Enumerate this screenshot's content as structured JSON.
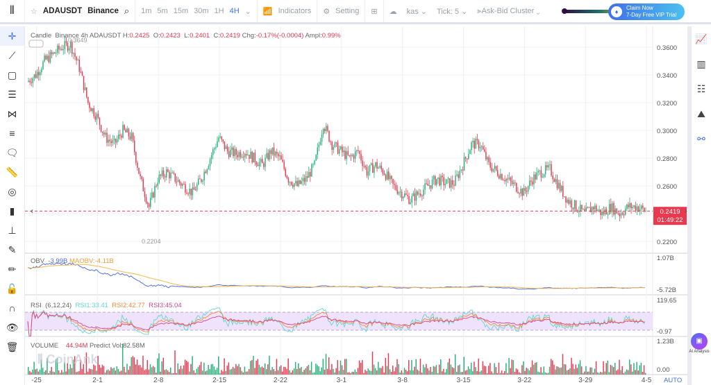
{
  "topbar": {
    "symbol": "ADAUSDT",
    "exchange": "Binance",
    "timeframes": [
      "1m",
      "5m",
      "15m",
      "30m",
      "1H",
      "4H"
    ],
    "active_timeframe": "4H",
    "indicators": "Indicators",
    "setting": "Setting",
    "kas": "kas",
    "tick": "Tick: 5",
    "cluster": "Ask-Bid Cluster",
    "claim_line1": "Claim Now",
    "claim_line2": "7-Day Free VIP Trial"
  },
  "legend": {
    "type": "Candle",
    "source": "Binance 4h ADAUSDT",
    "h_label": "H:",
    "h": "0.2425",
    "o_label": "O:",
    "o": "0.2423",
    "l_label": "L:",
    "l": "0.2401",
    "c_label": "C:",
    "c": "0.2419",
    "chg_label": "Chg:",
    "chg": "-0.17%(-0.0004)",
    "ampl_label": "Ampl:",
    "ampl": "0.99%",
    "high_mark": "0.3649",
    "low_mark": "0.2204"
  },
  "obv": {
    "label": "OBV",
    "value": "-3.99B",
    "ma": "MAOBV:-4.11B",
    "axis_top": "1.07B",
    "axis_bottom": "-5.72B"
  },
  "rsi": {
    "label": "RSI",
    "params": "(6,12,24)",
    "rsi1": "RSI1:33.41",
    "rsi2": "RSI2:42.77",
    "rsi3": "RSI3:45.04",
    "axis_top": "119.65",
    "axis_bottom": "-0.97"
  },
  "volume": {
    "label": "VOLUME",
    "value": "44.94M",
    "predict": "Predict Vol:82.58M",
    "axis_top": "1.23B",
    "axis_bottom": "0.00"
  },
  "price_axis": [
    "0.3600",
    "0.3400",
    "0.3200",
    "0.3000",
    "0.2800",
    "0.2600",
    "0.2200"
  ],
  "current_price": "0.2419",
  "countdown": "01:49:22",
  "x_axis": [
    "-25",
    "2-1",
    "2-8",
    "2-15",
    "2-22",
    "3-1",
    "3-8",
    "3-15",
    "3-22",
    "3-29",
    "4-5"
  ],
  "auto": "AUTO",
  "watermark": "CoinAnk",
  "ai_label": "AI Analysis",
  "colors": {
    "up": "#26b07a",
    "down": "#e8394f",
    "accent": "#3f6fe8",
    "obv": "#5470e0",
    "maobv": "#f2b84b",
    "rsi1": "#5fd6d0",
    "rsi2": "#f28a3c",
    "rsi3": "#d9448f"
  },
  "chart_data": {
    "type": "candlestick",
    "x_unit": "day",
    "start": "1-24",
    "ylim": [
      0.21,
      0.37
    ],
    "daily_close": [
      0.335,
      0.34,
      0.35,
      0.355,
      0.36,
      0.362,
      0.345,
      0.32,
      0.31,
      0.295,
      0.29,
      0.3,
      0.295,
      0.265,
      0.245,
      0.265,
      0.27,
      0.265,
      0.26,
      0.255,
      0.265,
      0.28,
      0.295,
      0.285,
      0.283,
      0.285,
      0.28,
      0.275,
      0.285,
      0.28,
      0.265,
      0.26,
      0.265,
      0.275,
      0.305,
      0.29,
      0.285,
      0.28,
      0.285,
      0.27,
      0.275,
      0.27,
      0.26,
      0.255,
      0.25,
      0.255,
      0.26,
      0.265,
      0.262,
      0.262,
      0.275,
      0.29,
      0.29,
      0.275,
      0.27,
      0.265,
      0.26,
      0.255,
      0.265,
      0.27,
      0.272,
      0.26,
      0.25,
      0.245,
      0.24,
      0.245,
      0.24,
      0.245,
      0.24,
      0.245,
      0.245,
      0.242
    ]
  }
}
